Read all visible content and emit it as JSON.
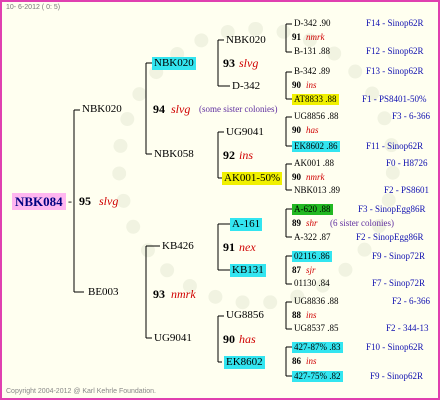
{
  "header": "10- 6-2012 ( 0: 5)",
  "footer": "Copyright 2004-2012 @ Karl Kehrle Foundation.",
  "root": {
    "name": "NBK084",
    "sep": "-"
  },
  "g1": [
    {
      "name": "NBK020",
      "num": "95",
      "tag": "slvg"
    },
    {
      "name": "BE003",
      "num": "93",
      "tag": "nmrk"
    }
  ],
  "g2": [
    {
      "name": "NBK020",
      "num": "94",
      "tag": "slvg",
      "note": "(some sister colonies)"
    },
    {
      "name": "NBK058",
      "num": "92",
      "tag": "ins"
    },
    {
      "name": "KB426",
      "num": "91",
      "tag": "nex"
    },
    {
      "name": "UG9041",
      "num": "90",
      "tag": "has"
    }
  ],
  "g3": [
    {
      "name": "NBK020",
      "num": "93",
      "tag": "slvg"
    },
    {
      "name": "D-342",
      "num": "",
      "tag": ""
    },
    {
      "name": "UG9041",
      "num": "",
      "tag": ""
    },
    {
      "name": "AK001-50%",
      "num": "90",
      "tag": "nmrk"
    },
    {
      "name": "A-161",
      "num": "",
      "tag": ""
    },
    {
      "name": "KB131",
      "num": "",
      "tag": ""
    },
    {
      "name": "UG8856",
      "num": "88",
      "tag": "ins"
    },
    {
      "name": "EK8602",
      "num": "86",
      "tag": "ins"
    }
  ],
  "g4": [
    {
      "name": "D-342 .90",
      "num": "91",
      "tag": "nmrk",
      "ref": "F14 - Sinop62R"
    },
    {
      "name": "B-131 .88",
      "ref": "F12 - Sinop62R"
    },
    {
      "name": "B-342 .89",
      "num": "90",
      "tag": "ins",
      "ref": "F13 - Sinop62R"
    },
    {
      "name": "AT8833 .88",
      "ref": "F1 - PS8401-50%"
    },
    {
      "name": "UG8856 .88",
      "num": "90",
      "tag": "has",
      "ref": "F3 - 6-366"
    },
    {
      "name": "EK8602 .86",
      "ref": "F11 - Sinop62R"
    },
    {
      "name": "AK001 .88",
      "num": "90",
      "tag": "nmrk",
      "ref": "F0 - H8726"
    },
    {
      "name": "NBK013 .89",
      "ref": "F2 - PS8601"
    },
    {
      "name": "A-620 .88",
      "num": "89",
      "tag": "shr",
      "note": "(6 sister colonies)",
      "ref": "F3 - SinopEgg86R"
    },
    {
      "name": "A-322 .87",
      "ref": "F2 - SinopEgg86R"
    },
    {
      "name": "02116 .86",
      "num": "87",
      "tag": "sjr",
      "ref": "F9 - Sinop72R"
    },
    {
      "name": "01130 .84",
      "ref": "F7 - Sinop72R"
    },
    {
      "name": "UG8836 .88",
      "num": "88",
      "tag": "ins",
      "ref": "F2 - 6-366"
    },
    {
      "name": "UG8537 .85",
      "ref": "F2 - 344-13"
    },
    {
      "name": "427-87% .83",
      "num": "86",
      "tag": "ins",
      "ref": "F10 - Sinop62R"
    },
    {
      "name": "427-75% .82",
      "ref": "F9 - Sinop62R"
    }
  ]
}
